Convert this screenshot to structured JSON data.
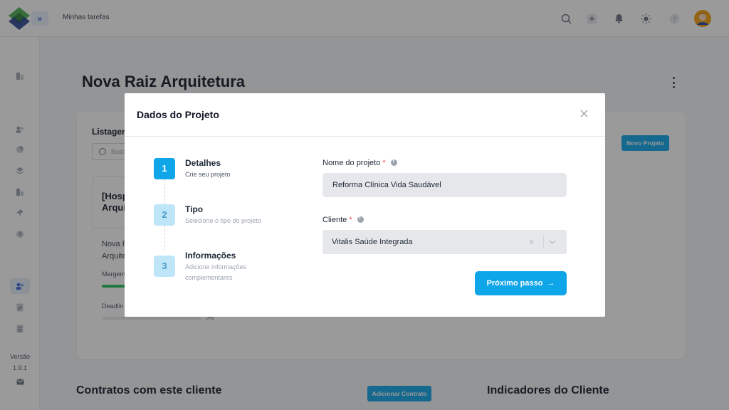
{
  "topbar": {
    "title": "Minhas tarefas",
    "expand_icon": "chevrons-right-icon",
    "icons": [
      "search-icon",
      "plus-icon",
      "bell-icon",
      "sun-icon",
      "help-icon",
      "avatar"
    ]
  },
  "sidebar": {
    "version_label": "Versão",
    "version_number": "1.9.1"
  },
  "page": {
    "title": "Nova Raiz Arquitetura",
    "list_label": "Listagem",
    "search_placeholder": "Busc",
    "new_project_label": "Novo Projeto",
    "project_card_title_line1": "[Hosp",
    "project_card_title_line2": "Arqui",
    "project_sub_line1": "Nova R",
    "project_sub_line2": "Arquite",
    "margin_label": "Margem",
    "margin_fill_percent": 40,
    "deadline_label": "Deadlin",
    "deadline_percent": "0%",
    "contracts_title": "Contratos com este cliente",
    "add_contract_label": "Adicionar Contrato",
    "indicators_title": "Indicadores do Cliente"
  },
  "modal": {
    "title": "Dados do Projeto",
    "steps": [
      {
        "number": "1",
        "title": "Detalhes",
        "description": "Crie seu projeto",
        "active": true
      },
      {
        "number": "2",
        "title": "Tipo",
        "description": "Selecione o tipo do projeto",
        "active": false
      },
      {
        "number": "3",
        "title": "Informações",
        "description_line1": "Adicione informações",
        "description_line2": "complementares",
        "active": false
      }
    ],
    "project_name_label": "Nome do projeto",
    "project_name_value": "Reforma Clínica Vida Saudável",
    "client_label": "Cliente",
    "client_value": "Vitalis Saúde Integrada",
    "required_mark": "*",
    "next_button_label": "Próximo passo",
    "colors": {
      "primary": "#0ea5e9",
      "required": "#ef4444"
    }
  }
}
